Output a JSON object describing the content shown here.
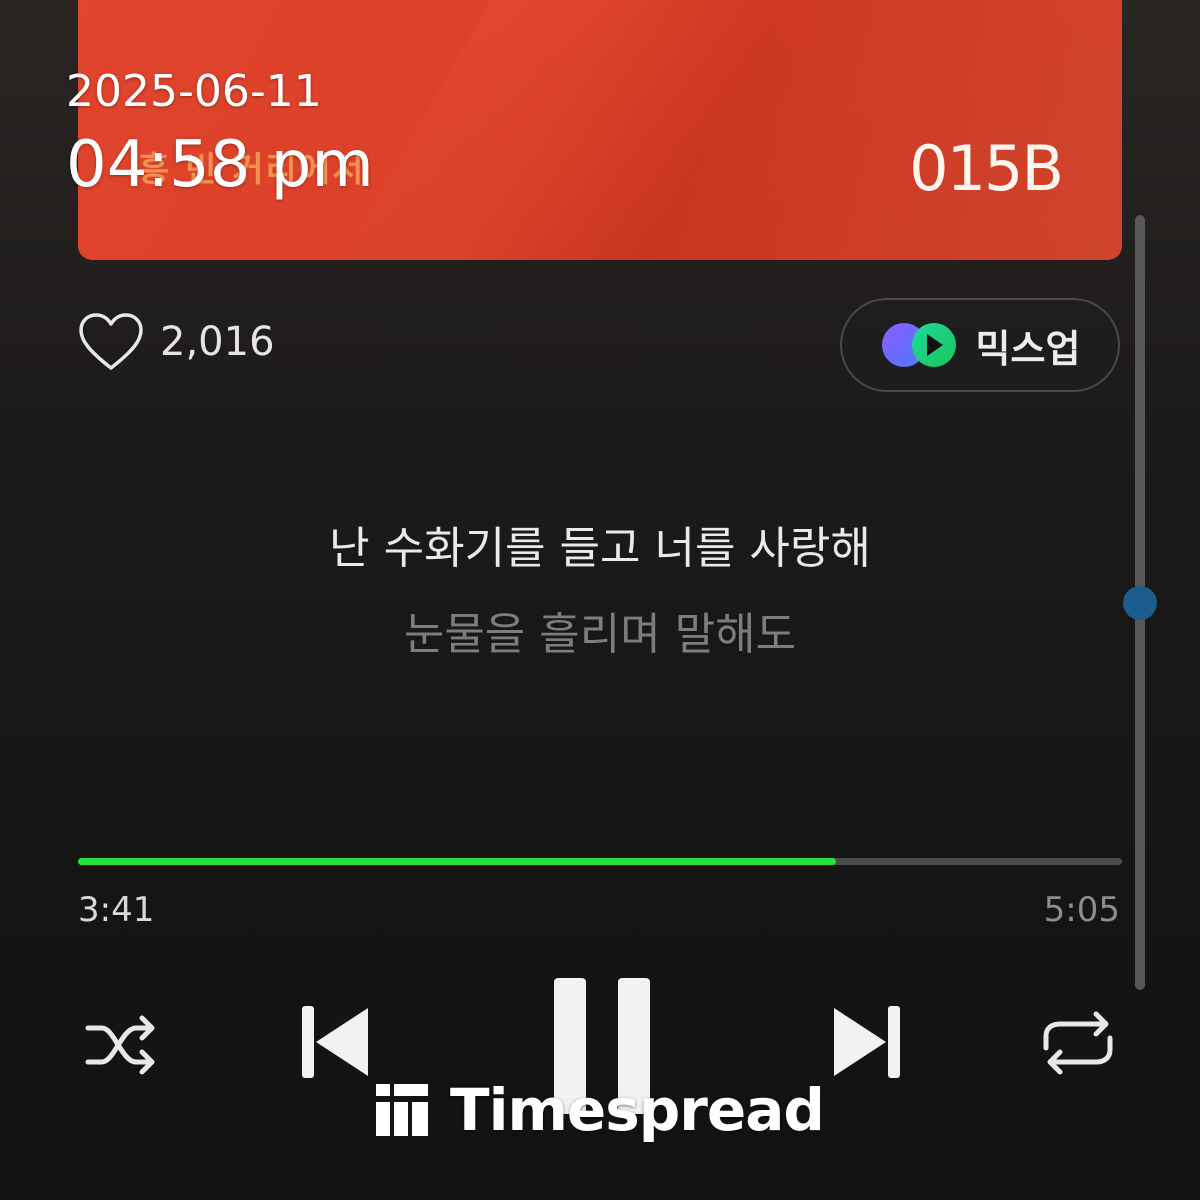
{
  "overlay": {
    "date": "2025-06-11",
    "time": "04:58 pm"
  },
  "album": {
    "subtitle": "흥 빈 거리에서",
    "logo_text": "015B",
    "color": "#dd3f28"
  },
  "like": {
    "icon": "heart-icon",
    "count": "2,016"
  },
  "mixup": {
    "icon": "mixup-icon",
    "label": "믹스업"
  },
  "lyrics": {
    "current": "난 수화기를 들고 너를 사랑해",
    "next": "눈물을 흘리며 말해도"
  },
  "playback": {
    "elapsed": "3:41",
    "total": "5:05",
    "progress_fraction": 0.726,
    "progress_color": "#22e33a"
  },
  "controls": {
    "shuffle": "shuffle-icon",
    "previous": "skip-previous-icon",
    "pause": "pause-icon",
    "next": "skip-next-icon",
    "repeat": "repeat-icon"
  },
  "watermark": {
    "text": "Timespread",
    "icon": "timespread-logo-icon"
  }
}
